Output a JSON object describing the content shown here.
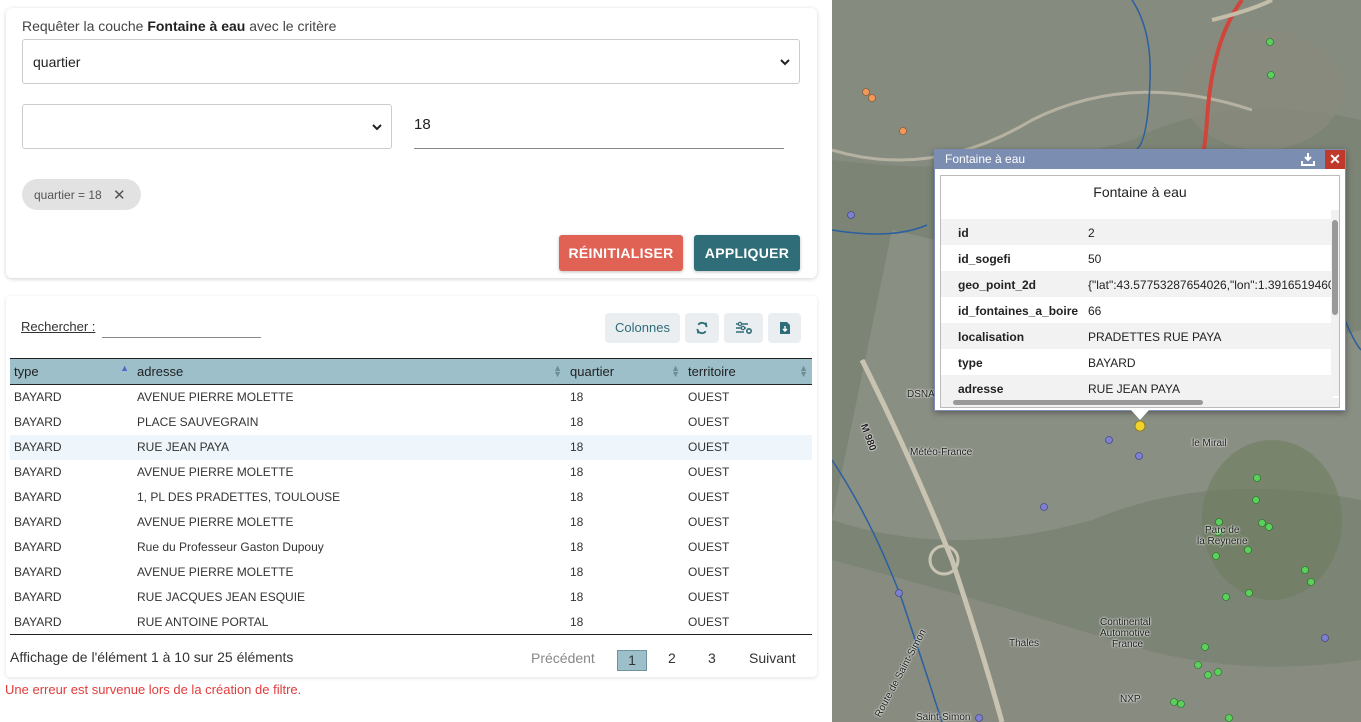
{
  "query": {
    "title_prefix": "Requêter la couche ",
    "layer_name": "Fontaine à eau",
    "title_suffix": " avec le critère",
    "field_value": "quartier",
    "operator_value": "",
    "input_value": "18",
    "chip_label": "quartier = 18",
    "reset_label": "RÉINITIALISER",
    "apply_label": "APPLIQUER"
  },
  "table": {
    "search_label": "Rechercher :",
    "columns_label": "Colonnes",
    "headers": [
      "type",
      "adresse",
      "quartier",
      "territoire"
    ],
    "rows": [
      [
        "BAYARD",
        "AVENUE PIERRE MOLETTE",
        "18",
        "OUEST"
      ],
      [
        "BAYARD",
        "PLACE SAUVEGRAIN",
        "18",
        "OUEST"
      ],
      [
        "BAYARD",
        "RUE JEAN PAYA",
        "18",
        "OUEST"
      ],
      [
        "BAYARD",
        "AVENUE PIERRE MOLETTE",
        "18",
        "OUEST"
      ],
      [
        "BAYARD",
        "1, PL DES PRADETTES, TOULOUSE",
        "18",
        "OUEST"
      ],
      [
        "BAYARD",
        "AVENUE PIERRE MOLETTE",
        "18",
        "OUEST"
      ],
      [
        "BAYARD",
        "Rue du Professeur Gaston Dupouy",
        "18",
        "OUEST"
      ],
      [
        "BAYARD",
        "AVENUE PIERRE MOLETTE",
        "18",
        "OUEST"
      ],
      [
        "BAYARD",
        "RUE JACQUES JEAN ESQUIE",
        "18",
        "OUEST"
      ],
      [
        "BAYARD",
        "RUE ANTOINE PORTAL",
        "18",
        "OUEST"
      ]
    ],
    "info": "Affichage de l'élément 1 à 10 sur 25 éléments",
    "pager": {
      "prev": "Précédent",
      "p1": "1",
      "p2": "2",
      "p3": "3",
      "next": "Suivant"
    }
  },
  "error_message": "Une erreur est survenue lors de la création de filtre.",
  "map": {
    "labels": [
      "DSNA",
      "Météo-France",
      "M 980",
      "le Mirail",
      "Parc de",
      "la Reynerie",
      "Continental",
      "Automotive",
      "France",
      "Thales",
      "NXP",
      "Route de Saint-Simon",
      "Saint-Simon"
    ],
    "popup": {
      "header": "Fontaine à eau",
      "title": "Fontaine à eau",
      "rows": [
        {
          "k": "id",
          "v": "2"
        },
        {
          "k": "id_sogefi",
          "v": "50"
        },
        {
          "k": "geo_point_2d",
          "v": "{\"lat\":43.57753287654026,\"lon\":1.3916519460"
        },
        {
          "k": "id_fontaines_a_boire",
          "v": "66"
        },
        {
          "k": "localisation",
          "v": "PRADETTES RUE PAYA"
        },
        {
          "k": "type",
          "v": "BAYARD"
        },
        {
          "k": "adresse",
          "v": "RUE JEAN PAYA"
        }
      ]
    }
  },
  "colors": {
    "reset": "#e06254",
    "apply": "#2f6d78",
    "header_bg": "#9cbfc9",
    "error": "#e23b3b",
    "popup_head": "#7b8db0"
  }
}
